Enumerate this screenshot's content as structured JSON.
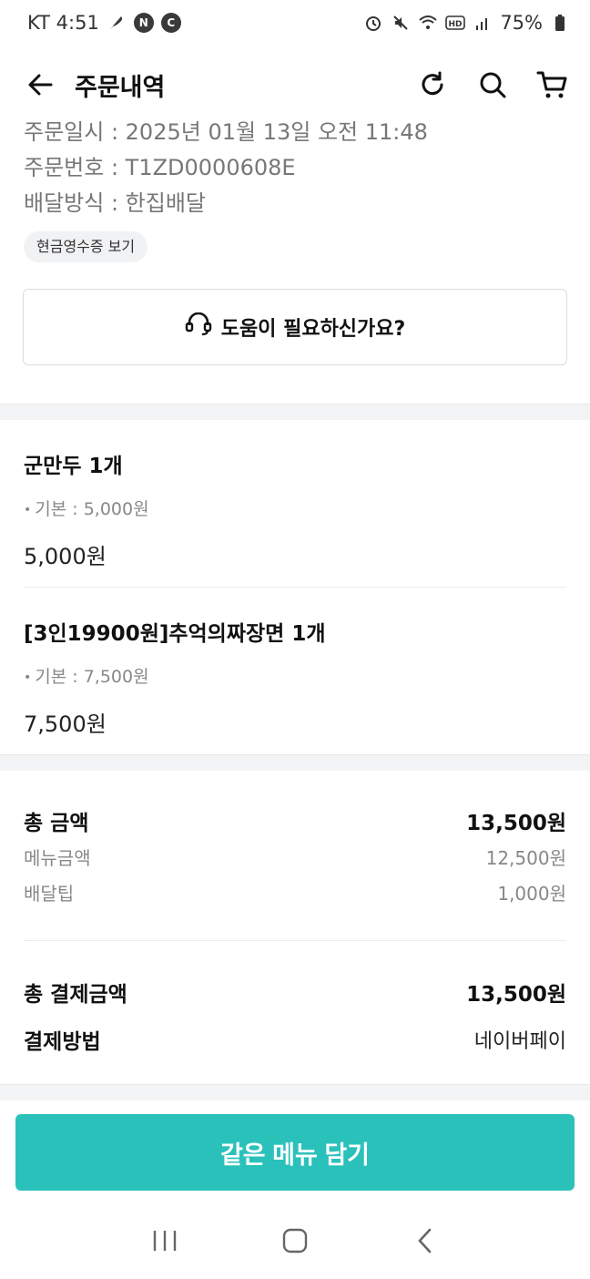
{
  "status_bar": {
    "carrier_time": "KT 4:51",
    "badges": [
      "N",
      "C"
    ],
    "battery": "75%",
    "icons": [
      "feather-icon",
      "alarm-icon",
      "mute-icon",
      "wifi-icon",
      "hd-icon",
      "signal-icon",
      "battery-icon"
    ]
  },
  "header": {
    "title": "주문내역",
    "icons": [
      "back-arrow-icon",
      "refresh-icon",
      "search-icon",
      "cart-icon"
    ]
  },
  "order_info": {
    "date_line": "주문일시 : 2025년 01월 13일 오전 11:48",
    "number_line": "주문번호 : T1ZD0000608E",
    "delivery_line": "배달방식 : 한집배달",
    "receipt_label": "현금영수증 보기"
  },
  "help": {
    "label": "도움이 필요하신가요?",
    "icon": "headset-icon"
  },
  "items": [
    {
      "name": "군만두 1개",
      "option": "기본 : 5,000원",
      "price": "5,000원"
    },
    {
      "name": "[3인19900원]추억의짜장면 1개",
      "option": "기본 : 7,500원",
      "price": "7,500원"
    }
  ],
  "totals": {
    "total_label": "총 금액",
    "total_value": "13,500원",
    "menu_label": "메뉴금액",
    "menu_value": "12,500원",
    "tip_label": "배달팁",
    "tip_value": "1,000원",
    "pay_total_label": "총 결제금액",
    "pay_total_value": "13,500원",
    "method_label": "결제방법",
    "method_value": "네이버페이"
  },
  "cta": {
    "label": "같은 메뉴 담기"
  },
  "colors": {
    "accent": "#2bc1bb",
    "muted_text": "#888888",
    "band": "#f3f4f6"
  }
}
